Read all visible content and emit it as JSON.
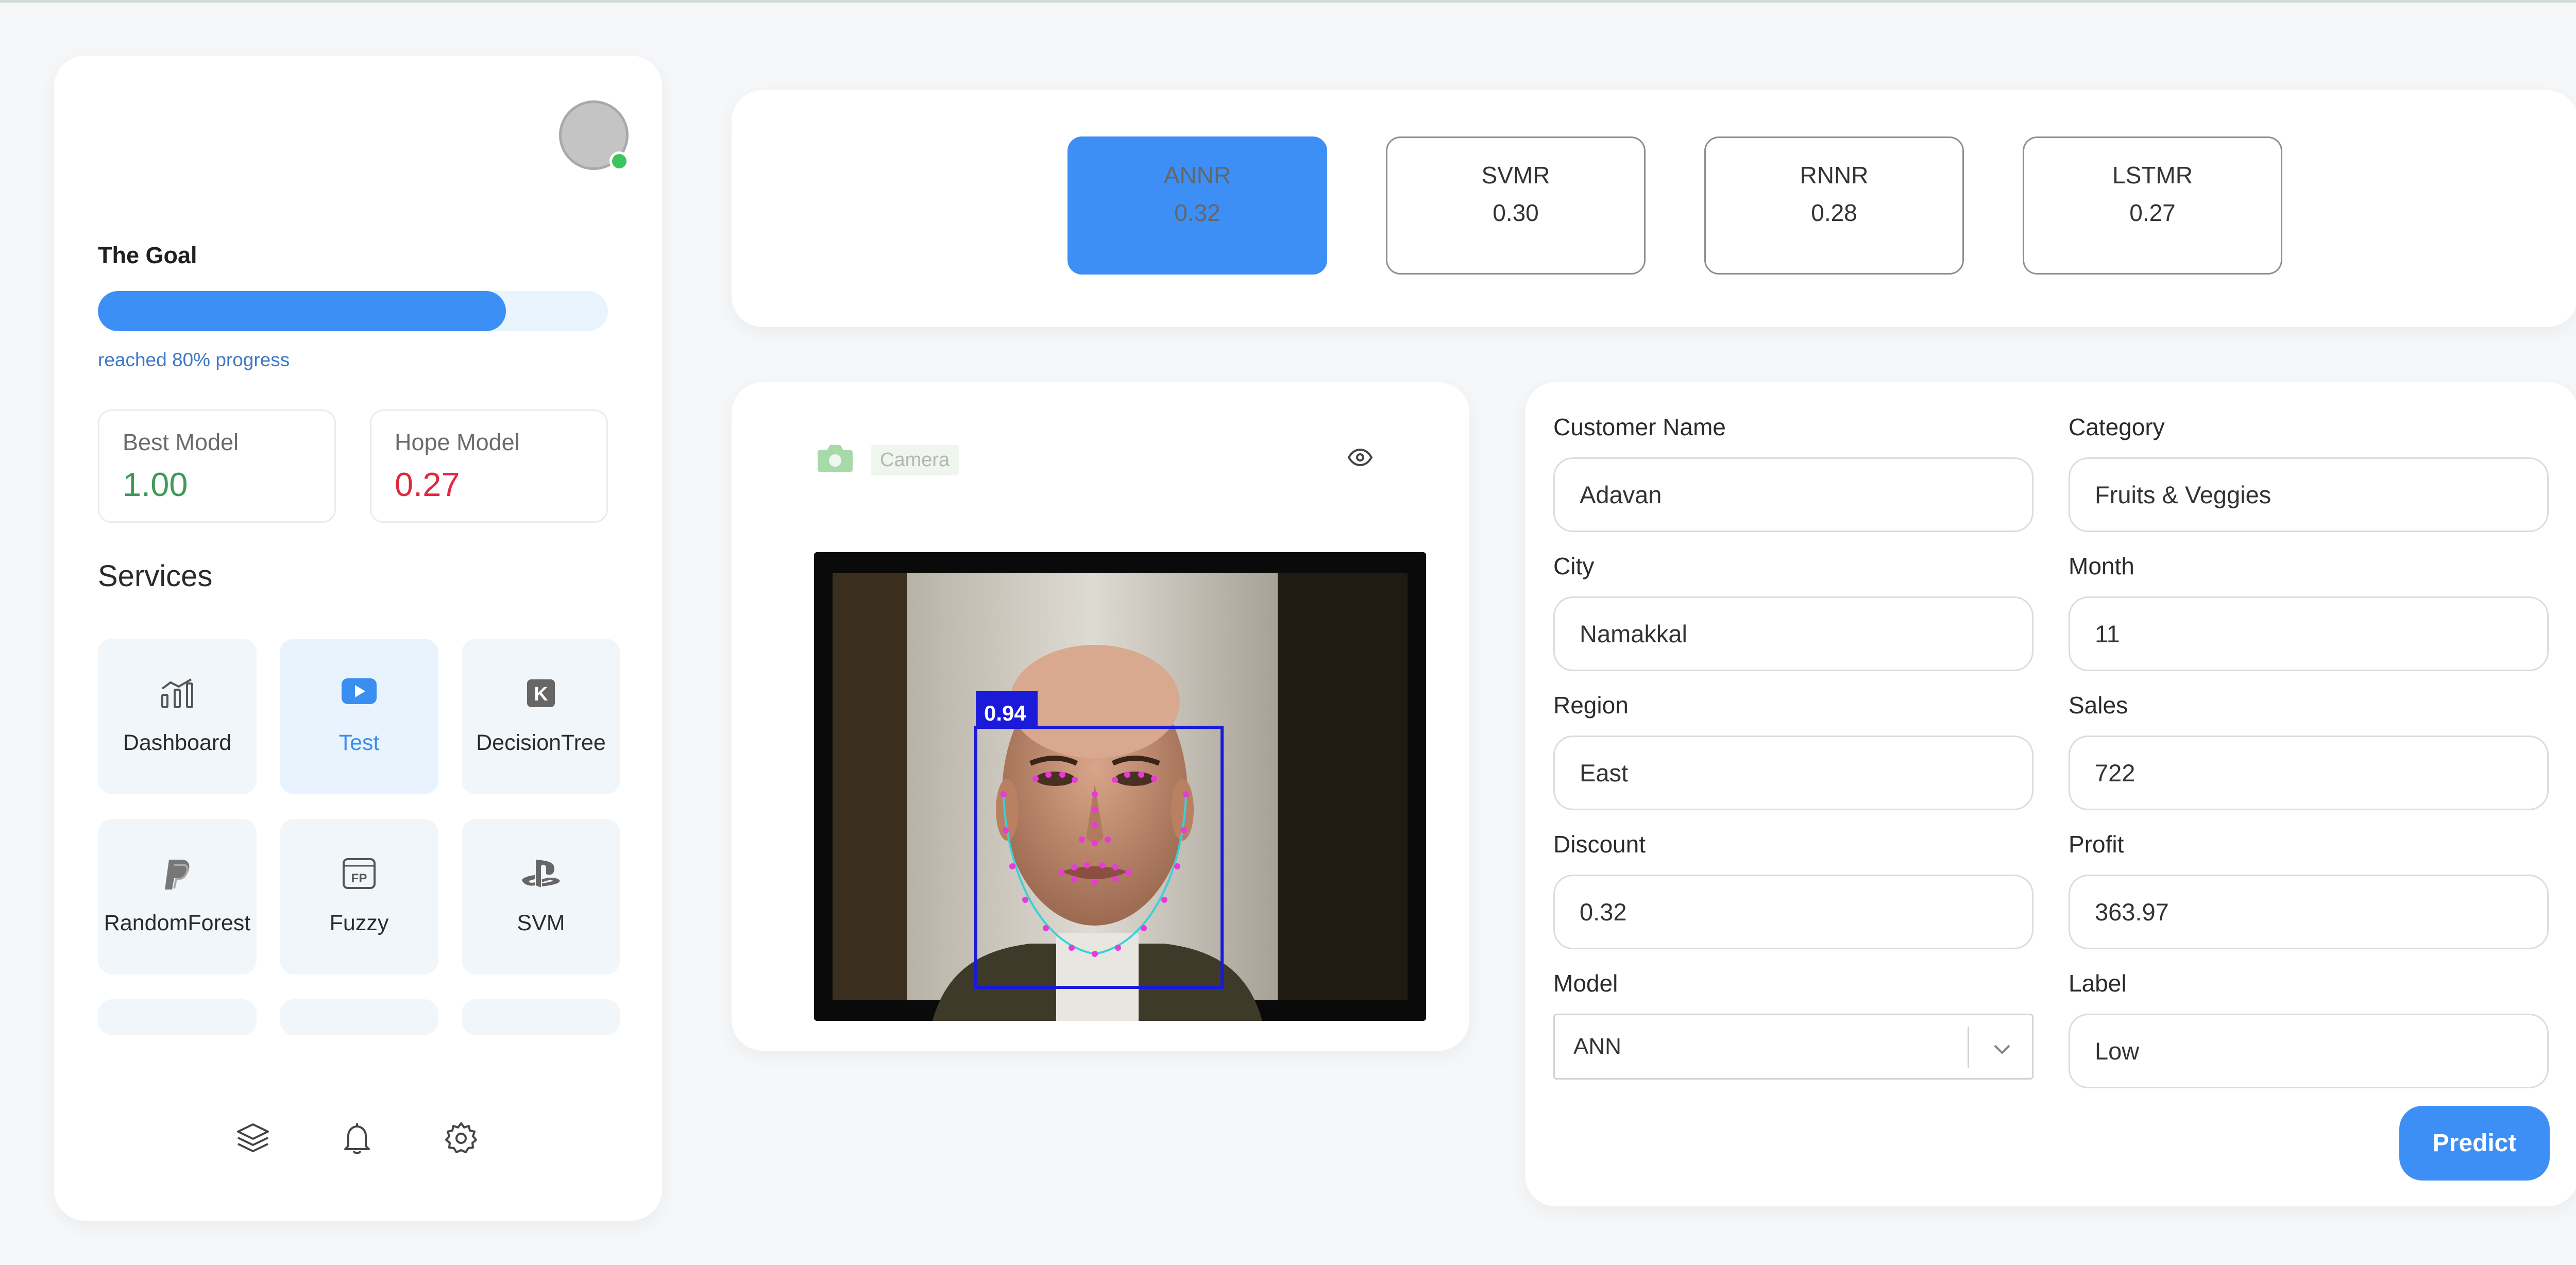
{
  "sidebar": {
    "goal_label": "The Goal",
    "progress_value": 0.8,
    "progress_text": "reached 80% progress",
    "best_model": {
      "label": "Best Model",
      "value": "1.00",
      "color": "#3f9a56"
    },
    "hope_model": {
      "label": "Hope Model",
      "value": "0.27",
      "color": "#e0283e"
    },
    "services_title": "Services",
    "services": [
      {
        "label": "Dashboard",
        "icon": "chart-icon",
        "active": false
      },
      {
        "label": "Test",
        "icon": "youtube-icon",
        "active": true
      },
      {
        "label": "DecisionTree",
        "icon": "k-badge-icon",
        "active": false
      },
      {
        "label": "RandomForest",
        "icon": "paypal-icon",
        "active": false
      },
      {
        "label": "Fuzzy",
        "icon": "fp-badge-icon",
        "active": false
      },
      {
        "label": "SVM",
        "icon": "playstation-icon",
        "active": false
      }
    ],
    "bottom_icons": [
      "layers-icon",
      "bell-icon",
      "gear-icon"
    ]
  },
  "models": [
    {
      "name": "ANNR",
      "value": "0.32",
      "active": true
    },
    {
      "name": "SVMR",
      "value": "0.30",
      "active": false
    },
    {
      "name": "RNNR",
      "value": "0.28",
      "active": false
    },
    {
      "name": "LSTMR",
      "value": "0.27",
      "active": false
    }
  ],
  "camera": {
    "label": "Camera",
    "detection_score": "0.94"
  },
  "form": {
    "customer_name": {
      "label": "Customer Name",
      "value": "Adavan"
    },
    "category": {
      "label": "Category",
      "value": "Fruits & Veggies"
    },
    "city": {
      "label": "City",
      "value": "Namakkal"
    },
    "month": {
      "label": "Month",
      "value": "11"
    },
    "region": {
      "label": "Region",
      "value": "East"
    },
    "sales": {
      "label": "Sales",
      "value": "722"
    },
    "discount": {
      "label": "Discount",
      "value": "0.32"
    },
    "profit": {
      "label": "Profit",
      "value": "363.97"
    },
    "model": {
      "label": "Model",
      "value": "ANN"
    },
    "label": {
      "label": "Label",
      "value": "Low"
    },
    "predict_label": "Predict"
  },
  "colors": {
    "accent": "#3d8ff6",
    "background": "#f6f7f8"
  }
}
